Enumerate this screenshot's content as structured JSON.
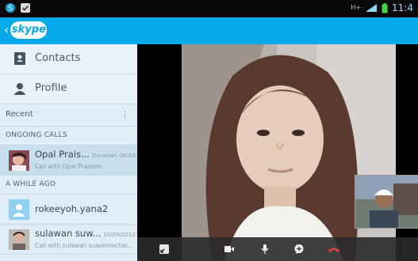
{
  "colors": {
    "accent": "#05a8e8",
    "sidebar": "#dfeef6",
    "end_call": "#e8302e"
  },
  "status_bar": {
    "network": "H+",
    "time": "11:4"
  },
  "app_bar": {
    "logo_text": "skype",
    "back_icon": "chevron-left-icon"
  },
  "nav": [
    {
      "label": "Contacts",
      "icon": "contacts-icon"
    },
    {
      "label": "Profile",
      "icon": "profile-icon"
    }
  ],
  "recent": {
    "label": "Recent",
    "menu_icon": "overflow-menu-icon"
  },
  "sections": {
    "ongoing": "ONGOING CALLS",
    "earlier": "A WHILE AGO"
  },
  "ongoing_call": {
    "name": "Opal Prais...",
    "meta": "Duration: 00:54",
    "sub": "Call with Opal Praisem"
  },
  "recent_calls": [
    {
      "name": "rokeeyoh.yana2"
    },
    {
      "name": "sulawan suw...",
      "meta": "10/09/2013",
      "sub": "Call with sulawan suwannachai..."
    }
  ],
  "controls": [
    "fullscreen-icon",
    "video-camera-icon",
    "microphone-icon",
    "chat-bubble-icon",
    "end-call-icon"
  ]
}
